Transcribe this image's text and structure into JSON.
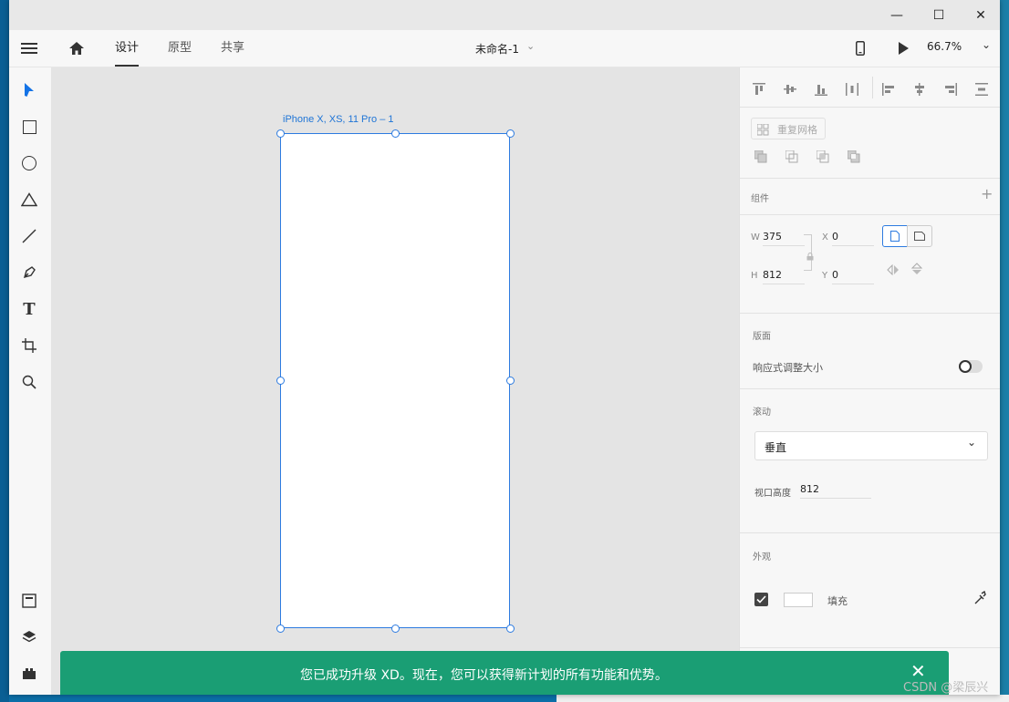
{
  "window_controls": {
    "minimize": "—",
    "maximize": "☐",
    "close": "✕"
  },
  "appbar": {
    "menu_icon": "hamburger-icon",
    "home_icon": "home-icon",
    "tabs": [
      {
        "label": "设计",
        "active": true
      },
      {
        "label": "原型",
        "active": false
      },
      {
        "label": "共享",
        "active": false
      }
    ],
    "doc_title": "未命名-1",
    "zoom": "66.7%"
  },
  "tools": [
    "select",
    "rectangle",
    "ellipse",
    "triangle",
    "line",
    "pen",
    "text",
    "artboard",
    "zoom",
    "assets",
    "layers",
    "plugins"
  ],
  "canvas": {
    "artboard_label": "iPhone X, XS, 11 Pro – 1"
  },
  "panel": {
    "repeat_grid": "重复网格",
    "components_title": "组件",
    "w_label": "W",
    "w_value": "375",
    "h_label": "H",
    "h_value": "812",
    "x_label": "X",
    "x_value": "0",
    "y_label": "Y",
    "y_value": "0",
    "artboard_section": "版面",
    "responsive_label": "响应式调整大小",
    "scroll_title": "滚动",
    "scroll_value": "垂直",
    "viewport_label": "视口高度",
    "viewport_value": "812",
    "appearance_title": "外观",
    "fill_label": "填充"
  },
  "toast": {
    "message": "您已成功升级 XD。现在，您可以获得新计划的所有功能和优势。"
  },
  "watermark": "CSDN @梁辰兴",
  "colors": {
    "accent": "#2d7be0",
    "toast": "#1a9e74"
  }
}
